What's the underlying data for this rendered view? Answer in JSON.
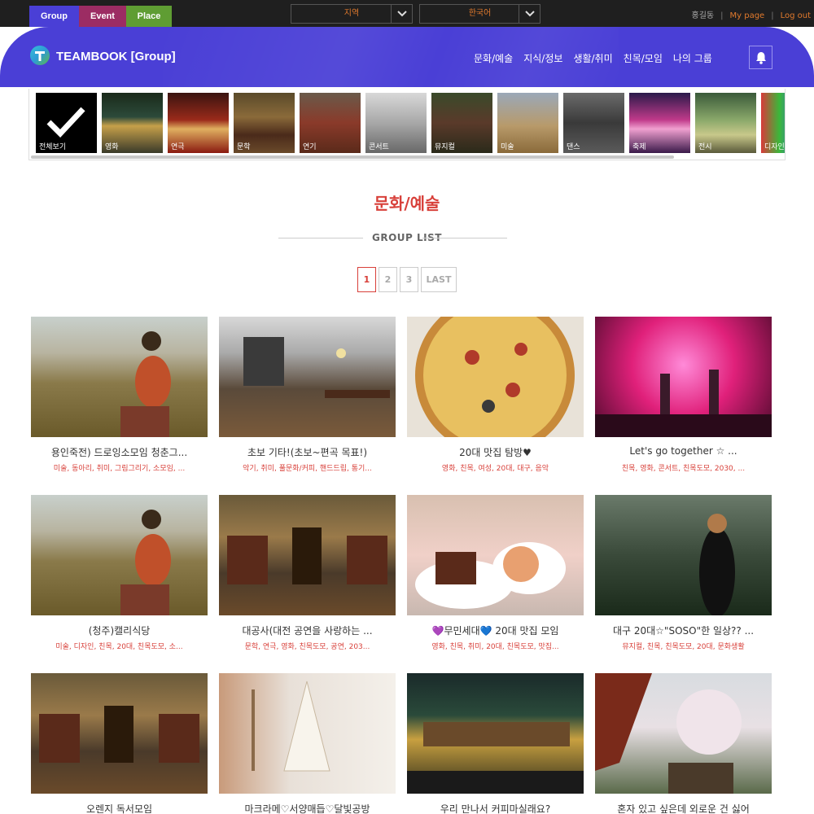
{
  "topbar": {
    "tabs": [
      "Group",
      "Event",
      "Place"
    ],
    "region_select": "지역",
    "language_select": "한국어",
    "user_name": "홍길동",
    "separator": "|",
    "my_page": "My page",
    "logout": "Log out"
  },
  "header": {
    "brand": "TEAMBOOK [Group]",
    "nav": [
      "문화/예술",
      "지식/정보",
      "생활/취미",
      "친목/모임",
      "나의 그룹"
    ]
  },
  "categories": [
    "전체보기",
    "영화",
    "연극",
    "문학",
    "연기",
    "콘서트",
    "뮤지컬",
    "미술",
    "댄스",
    "축제",
    "전시",
    "디자인"
  ],
  "page": {
    "title": "문화/예술",
    "subtitle": "GROUP LIST"
  },
  "pagination": [
    "1",
    "2",
    "3",
    "LAST"
  ],
  "groups": [
    {
      "title": "용인죽전) 드로잉소모임 청춘그...",
      "tags": "미술, 동아리, 취미, 그림그리기, 소모임, ..."
    },
    {
      "title": "초보 기타!(초보~편곡 목표!)",
      "tags": "악기, 취미, 풀문화/커피, 핸드드립, 통기..."
    },
    {
      "title": "20대 맛집 탐방♥",
      "tags": "영화, 친목, 여성, 20대, 대구, 음악"
    },
    {
      "title": "Let's go together ☆ ...",
      "tags": "친목, 영화, 콘서트, 친목도모, 2030, ..."
    },
    {
      "title": "(청주)캘리식당",
      "tags": "미술, 디자인, 친목, 20대, 친목도모, 소..."
    },
    {
      "title": "대공사(대전 공연을 사랑하는 ...",
      "tags": "문학, 연극, 영화, 친목도모, 공연, 203..."
    },
    {
      "title": "💜무민세대💙 20대 맛집 모임",
      "tags": "영화, 친목, 취미, 20대, 친목도모, 맛집..."
    },
    {
      "title": "대구 20대☆\"SOSO\"한 일상?? ...",
      "tags": "뮤지컬, 친목, 친목도모, 20대, 문화생활"
    },
    {
      "title": "오렌지 독서모임",
      "tags": ""
    },
    {
      "title": "마크라메♡서양매듭♡달빛공방",
      "tags": ""
    },
    {
      "title": "우리 만나서 커피마실래요?",
      "tags": ""
    },
    {
      "title": "혼자 있고 싶은데 외로운 건 싫어",
      "tags": ""
    }
  ],
  "colors": {
    "accent_blue": "#4a3fd6",
    "event_tab": "#9c2c63",
    "place_tab": "#5f9d33",
    "title_red": "#d8403a",
    "link_orange": "#e17a2d"
  }
}
